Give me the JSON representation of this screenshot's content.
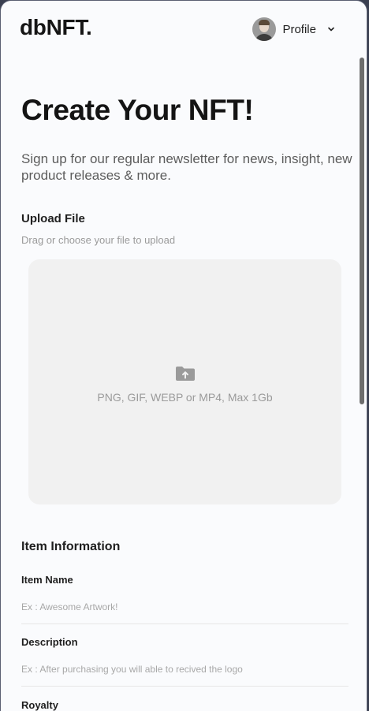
{
  "header": {
    "logo": "dbNFT.",
    "profile_label": "Profile"
  },
  "icons": {
    "avatar": "avatar",
    "profile_chevron": "chevron-down-icon",
    "upload": "folder-upload-icon"
  },
  "main": {
    "title": "Create Your NFT!",
    "subtitle": "Sign up for our regular newsletter for news, insight, new product releases & more.",
    "upload": {
      "label": "Upload File",
      "help": "Drag or choose your file to upload",
      "dropzone_text": "PNG, GIF, WEBP or MP4, Max 1Gb"
    },
    "item_info": {
      "label": "Item Information",
      "fields": [
        {
          "label": "Item Name",
          "placeholder": "Ex : Awesome Artwork!",
          "value": ""
        },
        {
          "label": "Description",
          "placeholder": "Ex : After purchasing you will able to recived the logo",
          "value": ""
        },
        {
          "label": "Royalty"
        }
      ]
    }
  },
  "colors": {
    "page_bg": "#fafbfd",
    "outer_bg": "#3a3f50",
    "dropzone_bg": "#f1f1f1",
    "text_primary": "#141414",
    "text_muted": "#9a9a9a"
  }
}
